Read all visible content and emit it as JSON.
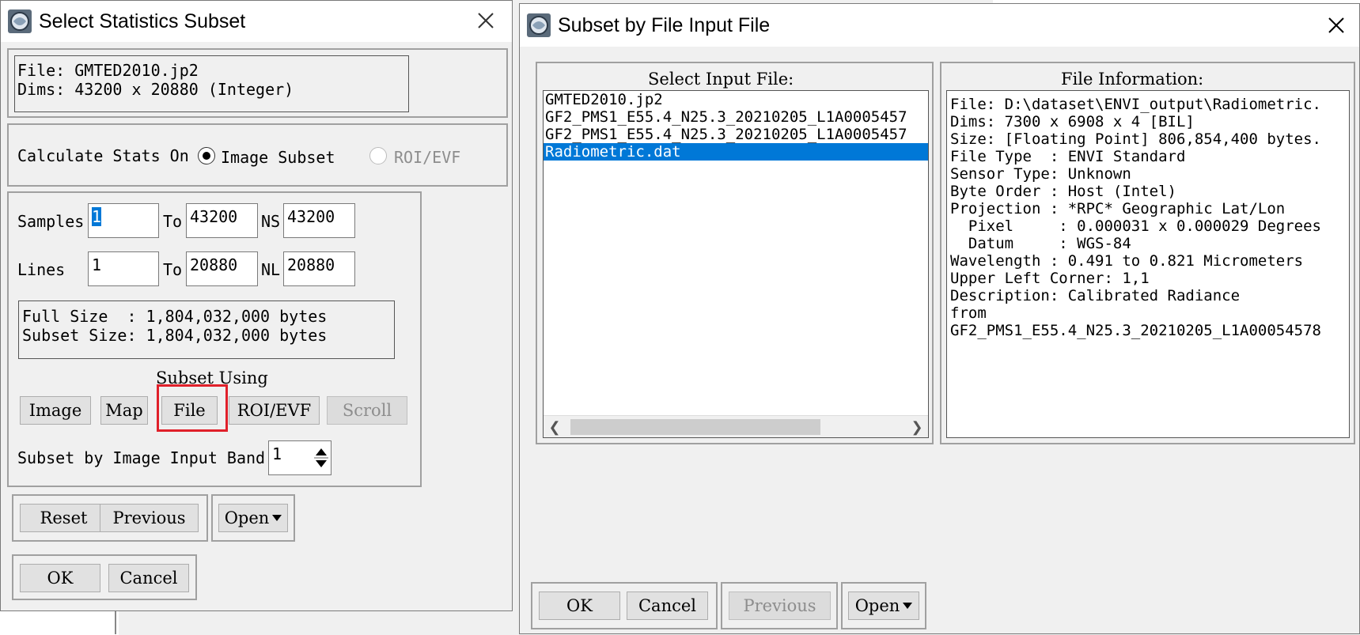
{
  "left_window": {
    "title": "Select Statistics Subset",
    "file_line": "File: GMTED2010.jp2",
    "dims_line": "Dims: 43200 x 20880 (Integer)",
    "calc_label": "Calculate Stats On",
    "radio_image": "Image Subset",
    "radio_roi": "ROI/EVF",
    "samples_label": "Samples",
    "samples_from": "1",
    "to_label": "To",
    "samples_to": "43200",
    "ns_label": "NS",
    "ns_value": "43200",
    "lines_label": "Lines",
    "lines_from": "1",
    "lines_to": "20880",
    "nl_label": "NL",
    "nl_value": "20880",
    "full_size": "Full Size  : 1,804,032,000 bytes",
    "subset_size": "Subset Size: 1,804,032,000 bytes",
    "subset_using": "Subset Using",
    "btn_image": "Image",
    "btn_map": "Map",
    "btn_file": "File",
    "btn_roi": "ROI/EVF",
    "btn_scroll": "Scroll",
    "band_label": "Subset by Image Input Band",
    "band_value": "1",
    "btn_reset": "Reset",
    "btn_previous": "Previous",
    "btn_open": "Open",
    "btn_ok": "OK",
    "btn_cancel": "Cancel"
  },
  "right_window": {
    "title": "Subset by File Input File",
    "select_header": "Select Input File:",
    "files": [
      "GMTED2010.jp2",
      "GF2_PMS1_E55.4_N25.3_20210205_L1A0005457",
      "GF2_PMS1_E55.4_N25.3_20210205_L1A0005457",
      "Radiometric.dat"
    ],
    "selected_index": 3,
    "info_header": "File Information:",
    "info_lines": [
      "File: D:\\dataset\\ENVI_output\\Radiometric.",
      "Dims: 7300 x 6908 x 4 [BIL]",
      "Size: [Floating Point] 806,854,400 bytes.",
      "File Type  : ENVI Standard",
      "Sensor Type: Unknown",
      "Byte Order : Host (Intel)",
      "Projection : *RPC* Geographic Lat/Lon",
      "  Pixel     : 0.000031 x 0.000029 Degrees",
      "  Datum     : WGS-84",
      "Wavelength : 0.491 to 0.821 Micrometers",
      "Upper Left Corner: 1,1",
      "Description: Calibrated Radiance",
      "from",
      "GF2_PMS1_E55.4_N25.3_20210205_L1A00054578"
    ],
    "btn_ok": "OK",
    "btn_cancel": "Cancel",
    "btn_previous": "Previous",
    "btn_open": "Open"
  },
  "colors": {
    "selection": "#0078d7",
    "highlight": "#e0202a"
  }
}
